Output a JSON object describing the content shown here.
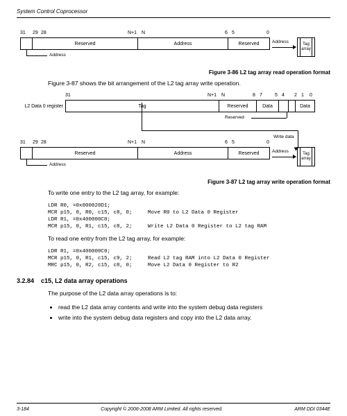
{
  "header": {
    "title": "System Control Coprocessor"
  },
  "diagram1": {
    "bits": {
      "b31": "31",
      "b29": "29",
      "b28": "28",
      "bNp1": "N+1",
      "bN": "N",
      "b6": "6",
      "b5": "5",
      "b0": "0"
    },
    "fields": {
      "f1": "Reserved",
      "f2": "Address",
      "f3": "Reserved"
    },
    "bottom_label": "Address",
    "arrow_label": "Address",
    "target": "Tag array",
    "caption": "Figure 3-86 L2 tag array read operation format"
  },
  "para1": "Figure 3-87 shows the bit arrangement of the L2 tag array write operation.",
  "diagram2": {
    "bits": {
      "b31": "31",
      "bNp1": "N+1",
      "bN": "N",
      "b8": "8",
      "b7": "7",
      "b5": "5",
      "b4": "4",
      "b2": "2",
      "b1": "1",
      "b0": "0"
    },
    "left_label": "L2 Data 0 register",
    "fields": {
      "tag": "Tag",
      "res1": "Reserved",
      "data1": "Data",
      "data2": "Data"
    },
    "res_label": "Reserved",
    "wd_label": "Write data"
  },
  "diagram3": {
    "bits": {
      "b31": "31",
      "b29": "29",
      "b28": "28",
      "bNp1": "N+1",
      "bN": "N",
      "b6": "6",
      "b5": "5",
      "b0": "0"
    },
    "fields": {
      "f1": "Reserved",
      "f2": "Address",
      "f3": "Reserved"
    },
    "bottom_label": "Address",
    "arrow_label": "Address",
    "target": "Tag array",
    "caption": "Figure 3-87 L2 tag array write operation format"
  },
  "para2": "To write one entry to the L2 tag array, for example:",
  "code1": "LDR R0, =0x000020D1;\nMCR p15, 0, R0, c15, c8, 0;     Move R0 to L2 Data 0 Register\nLDR R1, =0x400000C0;\nMCR p15, 0, R1, c15, c8, 2;     Write L2 Data 0 Register to L2 tag RAM",
  "para3": "To read one entry from the L2 tag array, for example:",
  "code2": "LDR R1, =0x400000C0;\nMCR p15, 0, R1, c15, c9, 2;     Read L2 tag RAM into L2 Data 0 Register\nMRC p15, 0, R2, c15, c8, 0;     Move L2 Data 0 Register to R2",
  "section": {
    "num": "3.2.84",
    "title": "c15, L2 data array operations"
  },
  "para4": "The purpose of the L2 data array operations is to:",
  "bullets": [
    "read the L2 data array contents and write into the system debug data registers",
    "write into the system debug data registers and copy into the L2 data array."
  ],
  "footer": {
    "left": "3-184",
    "mid": "Copyright © 2006-2008 ARM Limited. All rights reserved.",
    "right": "ARM DDI 0344E"
  }
}
